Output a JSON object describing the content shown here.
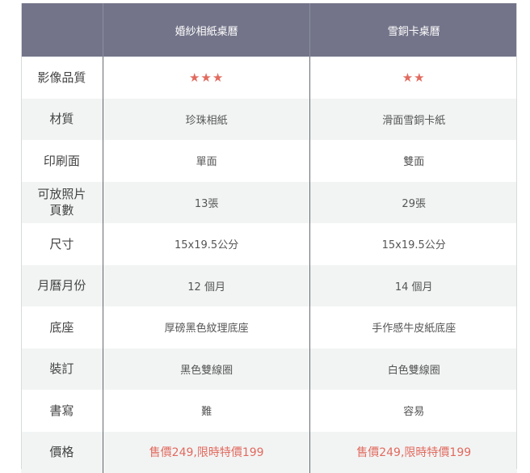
{
  "header": {
    "col1": "婚紗相紙桌曆",
    "col2": "雪銅卡桌曆"
  },
  "rows": [
    {
      "label": "影像品質",
      "col1": "★★★",
      "col2": "★★"
    },
    {
      "label": "材質",
      "col1": "珍珠相紙",
      "col2": "滑面雪銅卡紙"
    },
    {
      "label": "印刷面",
      "col1": "單面",
      "col2": "雙面"
    },
    {
      "label": "可放照片\n頁數",
      "col1": "13張",
      "col2": "29張"
    },
    {
      "label": "尺寸",
      "col1": "15x19.5公分",
      "col2": "15x19.5公分"
    },
    {
      "label": "月曆月份",
      "col1": "12 個月",
      "col2": "14 個月"
    },
    {
      "label": "底座",
      "col1": "厚磅黑色紋理底座",
      "col2": "手作感牛皮紙底座"
    },
    {
      "label": "裝訂",
      "col1": "黑色雙線圈",
      "col2": "白色雙線圈"
    },
    {
      "label": "書寫",
      "col1": "難",
      "col2": "容易"
    },
    {
      "label": "價格",
      "col1": "售價249,限時特價199",
      "col2": "售價249,限時特價199"
    }
  ],
  "colors": {
    "header_bg": "#737489",
    "accent": "#e16a5e",
    "alt_row": "#f2f4f4"
  }
}
